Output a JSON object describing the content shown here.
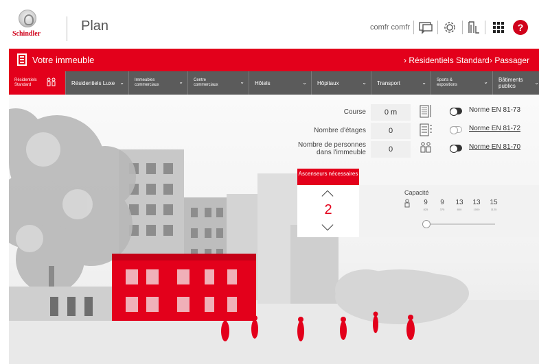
{
  "header": {
    "logo_text": "Schindler",
    "app_title": "Plan",
    "user_name": "comfr comfr",
    "icons": [
      "chat-icon",
      "gear-icon",
      "elevator-icon",
      "grid-icon",
      "help-icon"
    ],
    "help_symbol": "?"
  },
  "redbar": {
    "title": "Votre immeuble",
    "links": [
      "› Résidentiels Standard",
      "› Passager"
    ]
  },
  "categories": [
    {
      "label": "Résidentiels Standard",
      "active": true
    },
    {
      "label": "Résidentiels Luxe"
    },
    {
      "label": "Immeubles commerciaux"
    },
    {
      "label": "Centre commerciaux"
    },
    {
      "label": "Hôtels"
    },
    {
      "label": "Hôpitaux"
    },
    {
      "label": "Transport"
    },
    {
      "label": "Sports & expositions"
    },
    {
      "label": "Bâtiments publics"
    }
  ],
  "form": {
    "course_label": "Course",
    "course_value": "0 m",
    "floors_label": "Nombre d'étages",
    "floors_value": "0",
    "persons_label": "Nombre de personnes dans l'immeuble",
    "persons_value": "0",
    "norms": [
      {
        "label": "Norme EN 81-73",
        "enabled": true
      },
      {
        "label": "Norme EN 81-72",
        "enabled": false
      },
      {
        "label": "Norme EN 81-70",
        "enabled": true
      }
    ]
  },
  "elevators": {
    "heading": "Ascenseurs nécessaires",
    "count": "2"
  },
  "capacity": {
    "title": "Capacité",
    "values": [
      "9",
      "9",
      "13",
      "13",
      "15"
    ],
    "sub_values": [
      "825",
      "375",
      "800",
      "1000",
      "1125"
    ],
    "slider_level": 0
  },
  "colors": {
    "brand_red": "#e3001b",
    "nav_gray": "#5b5b5b"
  }
}
